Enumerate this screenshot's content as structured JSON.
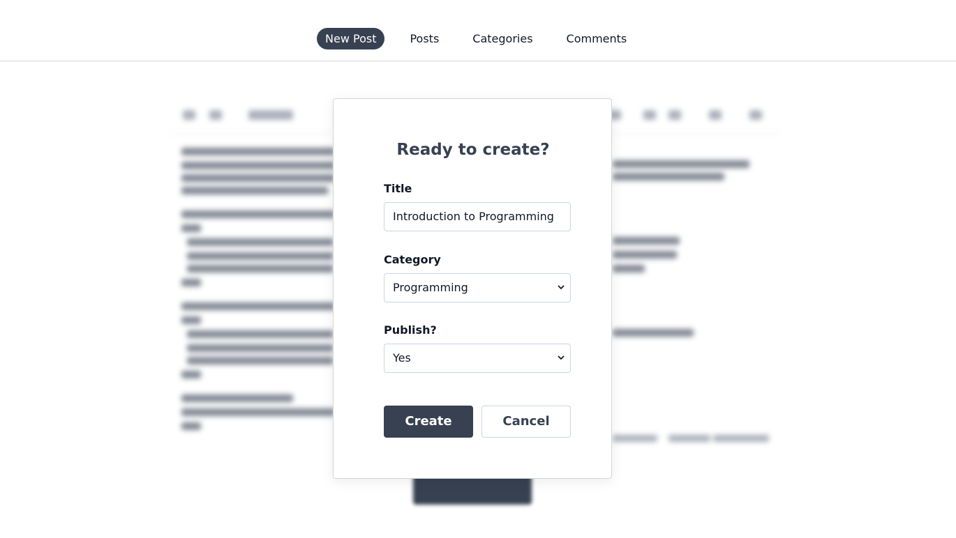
{
  "nav": {
    "items": [
      {
        "label": "New Post",
        "active": true
      },
      {
        "label": "Posts",
        "active": false
      },
      {
        "label": "Categories",
        "active": false
      },
      {
        "label": "Comments",
        "active": false
      }
    ]
  },
  "modal": {
    "title": "Ready to create?",
    "title_field": {
      "label": "Title",
      "value": "Introduction to Programming"
    },
    "category_field": {
      "label": "Category",
      "value": "Programming"
    },
    "publish_field": {
      "label": "Publish?",
      "value": "Yes"
    },
    "create_label": "Create",
    "cancel_label": "Cancel"
  },
  "colors": {
    "accent": "#374151",
    "border": "#cbd5e1"
  },
  "icons": {
    "select_arrow": "chevron-down-icon"
  }
}
